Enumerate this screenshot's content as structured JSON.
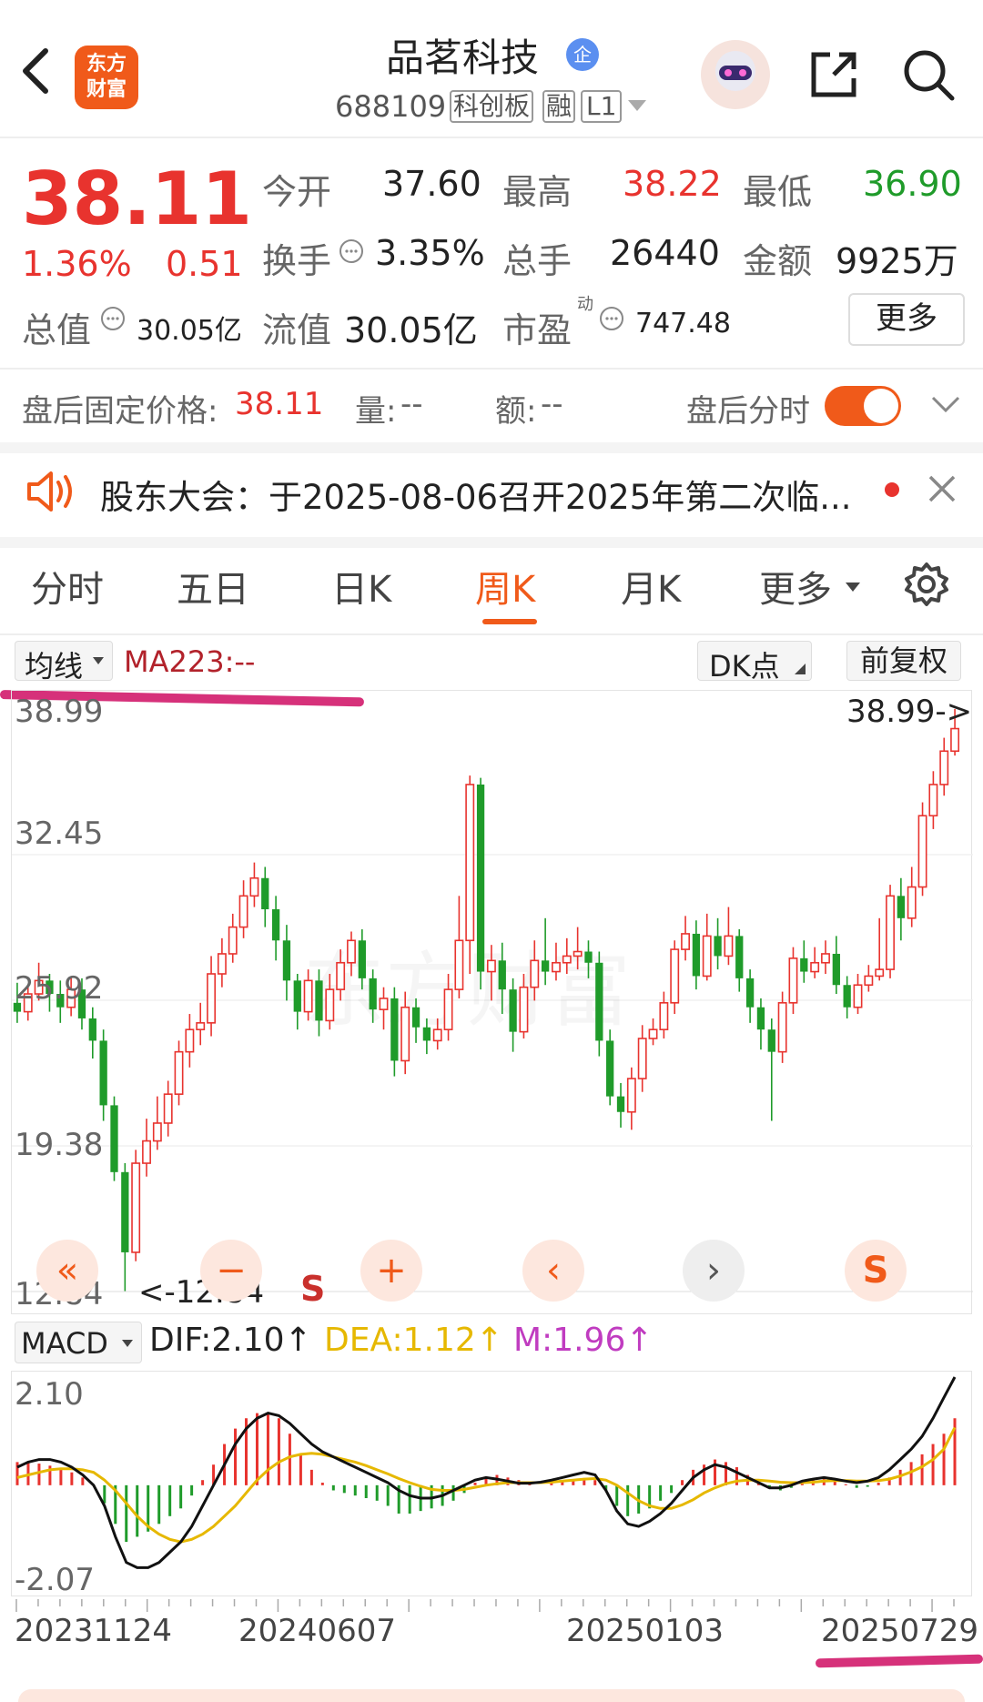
{
  "header": {
    "stock_name": "品茗科技",
    "enterprise_badge": "企",
    "code": "688109",
    "board_tag": "科创板",
    "margin_tag": "融",
    "level_tag": "L1",
    "logo_line1": "东方",
    "logo_line2": "财富"
  },
  "quote": {
    "price": "38.11",
    "change_pct": "1.36%",
    "change_amt": "0.51",
    "open_label": "今开",
    "open": "37.60",
    "high_label": "最高",
    "high": "38.22",
    "low_label": "最低",
    "low": "36.90",
    "turnover_label": "换手",
    "turnover": "3.35%",
    "volume_label": "总手",
    "volume": "26440",
    "amount_label": "金额",
    "amount": "9925万",
    "total_mv_label": "总值",
    "total_mv": "30.05亿",
    "float_mv_label": "流值",
    "float_mv": "30.05亿",
    "pe_label": "市盈",
    "pe_sup": "动",
    "pe": "747.48",
    "more_button": "更多"
  },
  "after_hours": {
    "fixed_price_label": "盘后固定价格:",
    "fixed_price": "38.11",
    "volume_label": "量:",
    "volume": "--",
    "amount_label": "额:",
    "amount": "--",
    "intraday_label": "盘后分时"
  },
  "notice": {
    "text": "股东大会：于2025-08-06召开2025年第二次临..."
  },
  "tabs": [
    "分时",
    "五日",
    "日K",
    "周K",
    "月K",
    "更多"
  ],
  "active_tab": "周K",
  "chart_toolbar": {
    "indicator_select": "均线",
    "ma_label": "MA223:--",
    "dk_button": "DK点",
    "adjust_button": "前复权"
  },
  "kline": {
    "y_labels": [
      "38.99",
      "32.45",
      "25.92",
      "19.38",
      "12.84"
    ],
    "high_marker": "38.99->",
    "low_marker": "<-12.84",
    "s_marker": "S",
    "watermark": "东方财富"
  },
  "controls": {
    "zoom_out": "«",
    "minus": "−",
    "plus": "+",
    "prev": "‹",
    "next": "›",
    "s_label": "S"
  },
  "macd": {
    "select": "MACD",
    "dif": "DIF:2.10",
    "dea": "DEA:1.12",
    "m": "M:1.96",
    "up_arrow": "↑",
    "y_top": "2.10",
    "y_bottom": "-2.07"
  },
  "x_axis": [
    "20231124",
    "20240607",
    "20250103",
    "20250729"
  ],
  "colors": {
    "up": "#e8332e",
    "down": "#1f9b2a",
    "accent": "#f05a1a",
    "dea_line": "#e6b800",
    "m_value": "#c03cc0",
    "annotation": "#d6317a"
  },
  "chart_data": {
    "type": "candlestick",
    "price_range": [
      12.84,
      38.99
    ],
    "candles": [
      [
        25.8,
        25.4,
        26.7,
        24.9
      ],
      [
        25.4,
        26.2,
        26.6,
        25.0
      ],
      [
        26.2,
        26.8,
        27.6,
        25.9
      ],
      [
        26.8,
        26.2,
        27.1,
        25.4
      ],
      [
        26.2,
        25.6,
        26.8,
        24.9
      ],
      [
        25.6,
        26.4,
        27.0,
        25.2
      ],
      [
        26.4,
        25.1,
        26.9,
        24.6
      ],
      [
        25.1,
        24.1,
        25.6,
        23.3
      ],
      [
        24.1,
        21.2,
        24.6,
        20.5
      ],
      [
        21.2,
        18.2,
        21.6,
        17.8
      ],
      [
        18.2,
        14.6,
        18.6,
        12.84
      ],
      [
        14.6,
        18.6,
        19.2,
        14.2
      ],
      [
        18.6,
        19.6,
        20.6,
        18.0
      ],
      [
        19.6,
        20.4,
        21.6,
        19.2
      ],
      [
        20.4,
        21.7,
        22.3,
        19.8
      ],
      [
        21.7,
        23.6,
        24.1,
        21.2
      ],
      [
        23.6,
        24.6,
        25.3,
        22.9
      ],
      [
        24.6,
        24.9,
        25.8,
        23.9
      ],
      [
        24.9,
        27.1,
        27.9,
        24.3
      ],
      [
        27.1,
        28.0,
        28.7,
        26.5
      ],
      [
        28.0,
        29.2,
        29.8,
        27.6
      ],
      [
        29.2,
        30.6,
        31.3,
        28.7
      ],
      [
        30.6,
        31.4,
        32.1,
        30.1
      ],
      [
        31.4,
        30.0,
        31.9,
        29.2
      ],
      [
        30.0,
        28.6,
        30.6,
        27.7
      ],
      [
        28.6,
        26.8,
        29.3,
        25.9
      ],
      [
        26.8,
        25.4,
        27.1,
        24.6
      ],
      [
        25.4,
        26.8,
        27.3,
        25.0
      ],
      [
        26.8,
        25.0,
        27.3,
        24.3
      ],
      [
        25.0,
        26.4,
        27.1,
        24.6
      ],
      [
        26.4,
        27.6,
        28.2,
        25.9
      ],
      [
        27.6,
        28.6,
        29.0,
        27.0
      ],
      [
        28.6,
        26.9,
        29.1,
        26.4
      ],
      [
        26.9,
        25.5,
        27.3,
        24.9
      ],
      [
        25.5,
        26.0,
        26.5,
        24.6
      ],
      [
        26.0,
        23.2,
        26.5,
        22.5
      ],
      [
        23.2,
        25.6,
        26.3,
        22.6
      ],
      [
        25.6,
        24.7,
        26.0,
        24.0
      ],
      [
        24.7,
        24.1,
        25.1,
        23.5
      ],
      [
        24.1,
        24.6,
        25.1,
        23.7
      ],
      [
        24.6,
        26.4,
        27.1,
        24.1
      ],
      [
        26.4,
        28.6,
        30.6,
        26.0
      ],
      [
        28.6,
        35.6,
        36.0,
        27.1
      ],
      [
        35.6,
        27.2,
        35.9,
        26.4
      ],
      [
        27.2,
        27.7,
        28.4,
        25.9
      ],
      [
        27.7,
        26.4,
        28.5,
        25.3
      ],
      [
        26.4,
        24.5,
        26.9,
        23.6
      ],
      [
        24.5,
        26.5,
        27.1,
        24.2
      ],
      [
        26.5,
        27.7,
        28.6,
        25.9
      ],
      [
        27.7,
        27.2,
        29.6,
        26.6
      ],
      [
        27.2,
        27.6,
        28.5,
        26.8
      ],
      [
        27.6,
        27.9,
        28.7,
        27.1
      ],
      [
        27.9,
        28.1,
        29.2,
        27.3
      ],
      [
        28.1,
        27.6,
        28.6,
        26.9
      ],
      [
        27.6,
        24.1,
        28.1,
        23.4
      ],
      [
        24.1,
        21.6,
        24.6,
        21.2
      ],
      [
        21.6,
        20.9,
        22.2,
        20.2
      ],
      [
        20.9,
        22.4,
        22.9,
        20.1
      ],
      [
        22.4,
        24.2,
        24.8,
        21.8
      ],
      [
        24.2,
        24.6,
        25.1,
        23.9
      ],
      [
        24.6,
        25.8,
        26.3,
        24.2
      ],
      [
        25.8,
        28.2,
        28.6,
        25.3
      ],
      [
        28.2,
        28.9,
        29.7,
        27.7
      ],
      [
        28.9,
        27.0,
        29.5,
        26.4
      ],
      [
        27.0,
        28.8,
        29.8,
        26.8
      ],
      [
        28.8,
        27.9,
        29.6,
        27.3
      ],
      [
        27.9,
        28.8,
        30.1,
        27.5
      ],
      [
        28.8,
        26.9,
        29.1,
        26.3
      ],
      [
        26.9,
        25.6,
        27.3,
        24.9
      ],
      [
        25.6,
        24.6,
        26.0,
        23.7
      ],
      [
        24.6,
        23.6,
        25.1,
        20.5
      ],
      [
        23.6,
        25.8,
        26.3,
        23.1
      ],
      [
        25.8,
        27.8,
        28.3,
        25.3
      ],
      [
        27.8,
        27.2,
        28.6,
        26.7
      ],
      [
        27.2,
        27.6,
        28.3,
        26.9
      ],
      [
        27.6,
        28.0,
        28.6,
        27.1
      ],
      [
        28.0,
        26.6,
        28.8,
        26.2
      ],
      [
        26.6,
        25.6,
        27.0,
        25.1
      ],
      [
        25.6,
        26.6,
        27.1,
        25.3
      ],
      [
        26.6,
        27.0,
        27.5,
        26.3
      ],
      [
        27.0,
        27.3,
        29.6,
        26.8
      ],
      [
        27.3,
        30.6,
        31.1,
        26.9
      ],
      [
        30.6,
        29.6,
        31.4,
        28.6
      ],
      [
        29.6,
        31.0,
        31.9,
        29.2
      ],
      [
        31.0,
        34.2,
        34.8,
        30.6
      ],
      [
        34.2,
        35.6,
        36.2,
        33.6
      ],
      [
        35.6,
        37.1,
        37.7,
        35.1
      ],
      [
        37.1,
        38.11,
        38.99,
        36.9
      ]
    ],
    "macd_range": [
      -2.07,
      2.1
    ],
    "macd_hist": [
      0.45,
      0.45,
      0.42,
      0.38,
      0.32,
      0.25,
      0.15,
      0.0,
      -0.35,
      -0.75,
      -1.1,
      -1.0,
      -0.9,
      -0.75,
      -0.6,
      -0.45,
      -0.2,
      0.1,
      0.4,
      0.8,
      1.1,
      1.3,
      1.4,
      1.4,
      1.3,
      1.0,
      0.6,
      0.3,
      0.05,
      -0.1,
      -0.15,
      -0.2,
      -0.25,
      -0.3,
      -0.4,
      -0.55,
      -0.55,
      -0.5,
      -0.45,
      -0.4,
      -0.3,
      -0.15,
      0.05,
      0.15,
      0.2,
      0.15,
      0.1,
      0.05,
      0.0,
      0.05,
      0.08,
      0.12,
      0.14,
      0.1,
      -0.1,
      -0.4,
      -0.6,
      -0.55,
      -0.45,
      -0.3,
      -0.15,
      0.1,
      0.3,
      0.4,
      0.5,
      0.45,
      0.35,
      0.2,
      0.05,
      -0.05,
      -0.1,
      -0.05,
      0.05,
      0.1,
      0.12,
      0.08,
      0.02,
      -0.05,
      -0.03,
      0.05,
      0.15,
      0.3,
      0.45,
      0.6,
      0.8,
      1.0,
      1.3
    ],
    "dif": [
      0.35,
      0.45,
      0.5,
      0.5,
      0.45,
      0.35,
      0.2,
      0.0,
      -0.4,
      -1.0,
      -1.5,
      -1.6,
      -1.6,
      -1.5,
      -1.3,
      -1.1,
      -0.8,
      -0.4,
      0.0,
      0.4,
      0.8,
      1.1,
      1.3,
      1.4,
      1.35,
      1.2,
      1.0,
      0.8,
      0.65,
      0.55,
      0.45,
      0.35,
      0.25,
      0.15,
      0.05,
      -0.1,
      -0.2,
      -0.25,
      -0.25,
      -0.2,
      -0.1,
      0.0,
      0.1,
      0.15,
      0.12,
      0.08,
      0.04,
      0.04,
      0.06,
      0.1,
      0.15,
      0.2,
      0.25,
      0.2,
      -0.1,
      -0.5,
      -0.75,
      -0.8,
      -0.7,
      -0.55,
      -0.35,
      -0.1,
      0.15,
      0.3,
      0.4,
      0.35,
      0.25,
      0.15,
      0.05,
      -0.05,
      -0.05,
      0.0,
      0.08,
      0.12,
      0.15,
      0.12,
      0.08,
      0.05,
      0.08,
      0.15,
      0.3,
      0.5,
      0.7,
      0.95,
      1.3,
      1.7,
      2.1
    ],
    "dea": [
      0.15,
      0.2,
      0.25,
      0.3,
      0.32,
      0.32,
      0.3,
      0.25,
      0.1,
      -0.1,
      -0.35,
      -0.6,
      -0.8,
      -0.95,
      -1.05,
      -1.1,
      -1.05,
      -0.95,
      -0.8,
      -0.6,
      -0.4,
      -0.15,
      0.1,
      0.3,
      0.45,
      0.55,
      0.6,
      0.62,
      0.6,
      0.55,
      0.5,
      0.45,
      0.38,
      0.3,
      0.22,
      0.13,
      0.05,
      -0.02,
      -0.08,
      -0.1,
      -0.1,
      -0.08,
      -0.04,
      0.0,
      0.03,
      0.05,
      0.05,
      0.05,
      0.05,
      0.06,
      0.08,
      0.1,
      0.12,
      0.13,
      0.1,
      0.0,
      -0.15,
      -0.3,
      -0.4,
      -0.45,
      -0.45,
      -0.38,
      -0.28,
      -0.15,
      -0.05,
      0.03,
      0.08,
      0.1,
      0.1,
      0.08,
      0.06,
      0.05,
      0.05,
      0.06,
      0.08,
      0.09,
      0.09,
      0.08,
      0.08,
      0.09,
      0.12,
      0.18,
      0.26,
      0.36,
      0.5,
      0.7,
      1.12
    ],
    "x_ticks": [
      "20231124",
      "20240607",
      "20250103",
      "20250729"
    ],
    "y_ticks": [
      "38.99",
      "32.45",
      "25.92",
      "19.38",
      "12.84"
    ]
  }
}
